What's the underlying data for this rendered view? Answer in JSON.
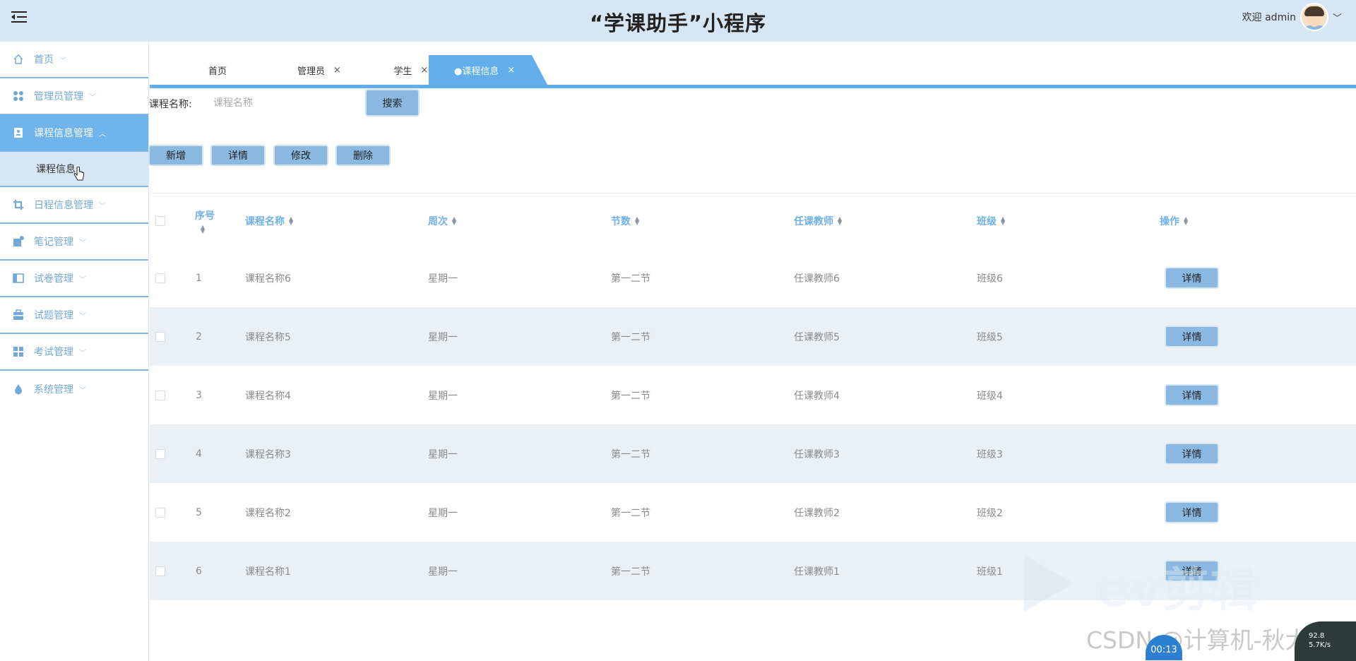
{
  "header": {
    "title": "“学课助手”小程序",
    "welcome": "欢迎 admin",
    "user_menu_icon": "chevron-down-icon"
  },
  "sidebar": {
    "items": [
      {
        "label": "首页",
        "icon": "home-icon",
        "chevron": "﹀"
      },
      {
        "label": "管理员管理",
        "icon": "apps-icon",
        "chevron": "﹀"
      },
      {
        "label": "课程信息管理",
        "icon": "id-card-icon",
        "chevron": "︿",
        "active": true
      },
      {
        "label": "日程信息管理",
        "icon": "crop-icon",
        "chevron": "﹀"
      },
      {
        "label": "笔记管理",
        "icon": "note-icon",
        "chevron": "﹀"
      },
      {
        "label": "试卷管理",
        "icon": "panel-icon",
        "chevron": "﹀"
      },
      {
        "label": "试题管理",
        "icon": "briefcase-icon",
        "chevron": "﹀"
      },
      {
        "label": "考试管理",
        "icon": "grid-icon",
        "chevron": "﹀"
      },
      {
        "label": "系统管理",
        "icon": "drop-icon",
        "chevron": "﹀"
      }
    ],
    "sub_item": "课程信息"
  },
  "tabs": [
    {
      "label": "首页"
    },
    {
      "label": "管理员",
      "close": "×"
    },
    {
      "label": "学生",
      "close": "×"
    },
    {
      "label": "●课程信息",
      "close": "×",
      "active": true
    }
  ],
  "search": {
    "label": "课程名称:",
    "placeholder": "课程名称",
    "button": "搜索"
  },
  "actions": {
    "add": "新增",
    "detail": "详情",
    "edit": "修改",
    "delete": "删除"
  },
  "table": {
    "columns": [
      "序号",
      "课程名称",
      "周次",
      "节数",
      "任课教师",
      "班级",
      "操作"
    ],
    "rows": [
      {
        "index": "1",
        "course": "课程名称6",
        "week": "星期一",
        "section": "第一二节",
        "teacher": "任课教师6",
        "class": "班级6"
      },
      {
        "index": "2",
        "course": "课程名称5",
        "week": "星期一",
        "section": "第一二节",
        "teacher": "任课教师5",
        "class": "班级5"
      },
      {
        "index": "3",
        "course": "课程名称4",
        "week": "星期一",
        "section": "第一二节",
        "teacher": "任课教师4",
        "class": "班级4"
      },
      {
        "index": "4",
        "course": "课程名称3",
        "week": "星期一",
        "section": "第一二节",
        "teacher": "任课教师3",
        "class": "班级3"
      },
      {
        "index": "5",
        "course": "课程名称2",
        "week": "星期一",
        "section": "第一二节",
        "teacher": "任课教师2",
        "class": "班级2"
      },
      {
        "index": "6",
        "course": "课程名称1",
        "week": "星期一",
        "section": "第一二节",
        "teacher": "任课教师1",
        "class": "班级1"
      }
    ],
    "row_button": "详情"
  },
  "overlays": {
    "ev_watermark": "ev剪辑",
    "csdn_watermark": "CSDN @计算机-秋大田",
    "timer": "00:13",
    "net_up": "92.8",
    "net_down": "5.7K/s"
  },
  "colors": {
    "header_bg": "#d6e6f5",
    "accent": "#62adeb",
    "button_bg": "#8ab8e0",
    "row_alt_bg": "#ebf0f4"
  }
}
